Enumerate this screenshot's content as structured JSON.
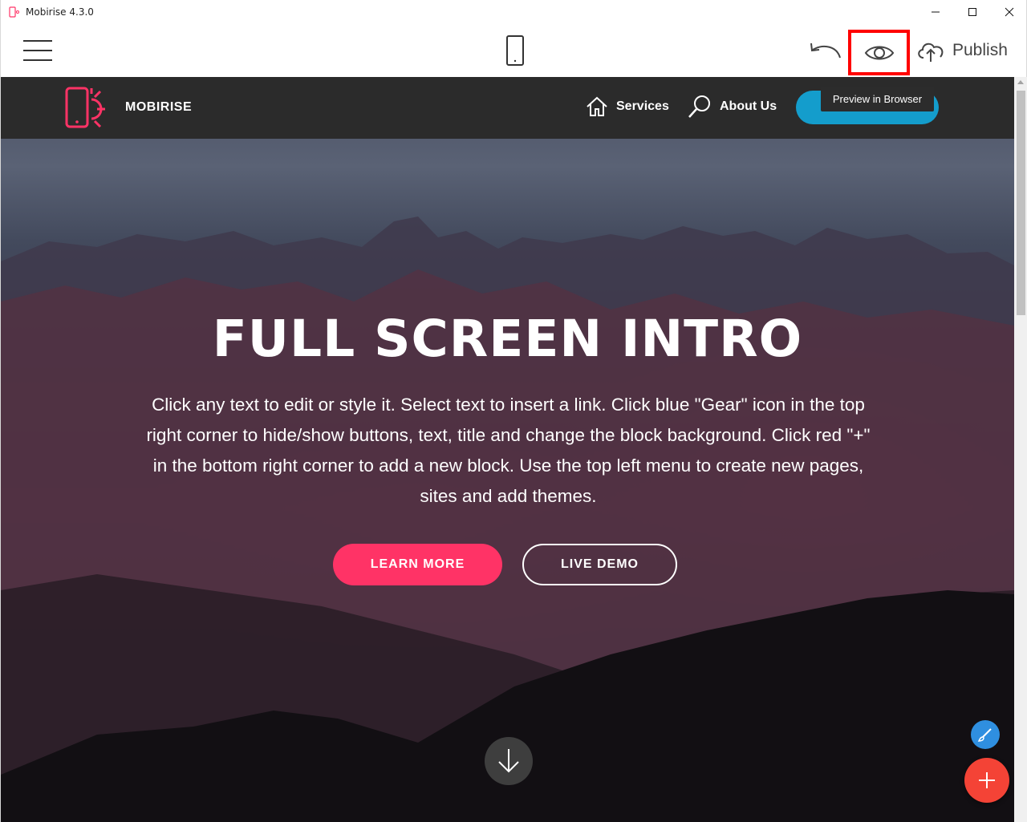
{
  "window": {
    "title": "Mobirise 4.3.0",
    "minimize_glyph": "—",
    "maximize_glyph": "☐",
    "close_glyph": "✕"
  },
  "toolbar": {
    "menu_icon": "hamburger-icon",
    "device_icon": "mobile-phone-icon",
    "undo_icon": "undo-icon",
    "preview_icon": "eye-icon",
    "publish_icon": "cloud-upload-icon",
    "publish_label": "Publish",
    "preview_tooltip": "Preview in Browser",
    "highlight_color": "#ff0000"
  },
  "site": {
    "brand": "MOBIRISE",
    "logo_icon": "phone-sun-logo",
    "logo_color": "#ff3366",
    "nav": [
      {
        "label": "Services",
        "icon": "home-icon"
      },
      {
        "label": "About Us",
        "icon": "search-icon"
      }
    ],
    "cta_color": "#149dcc"
  },
  "hero": {
    "title": "FULL SCREEN INTRO",
    "text": "Click any text to edit or style it. Select text to insert a link. Click blue \"Gear\" icon in the top right corner to hide/show buttons, text, title and change the block background. Click red \"+\" in the bottom right corner to add a new block. Use the top left menu to create new pages, sites and add themes.",
    "primary_button": "LEARN MORE",
    "secondary_button": "LIVE DEMO",
    "primary_color": "#ff3366",
    "scroll_icon": "arrow-down-icon"
  },
  "fabs": {
    "edit_icon": "brush-icon",
    "edit_color": "#2f8fe0",
    "add_icon": "plus-icon",
    "add_color": "#f44336"
  }
}
